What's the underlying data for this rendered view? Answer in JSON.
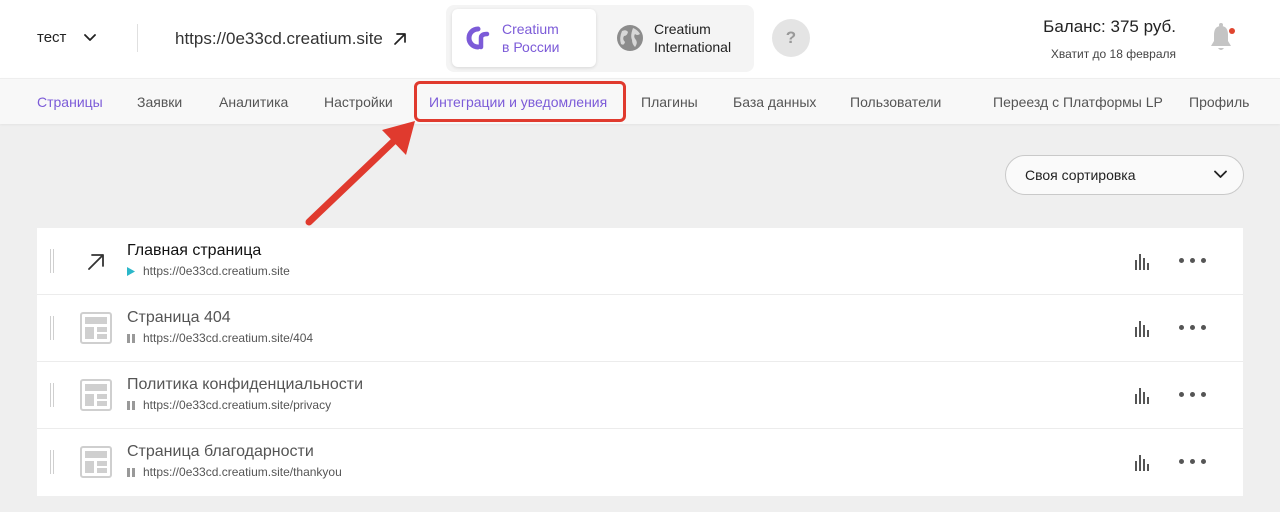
{
  "header": {
    "project_name": "тест",
    "site_url": "https://0e33cd.creatium.site",
    "region_ru_line1": "Creatium",
    "region_ru_line2": "в России",
    "region_int_line1": "Creatium",
    "region_int_line2": "International",
    "help_label": "?",
    "balance": "Баланс: 375 руб.",
    "balance_sub": "Хватит до 18 февраля"
  },
  "nav": {
    "items": [
      {
        "label": "Страницы"
      },
      {
        "label": "Заявки"
      },
      {
        "label": "Аналитика"
      },
      {
        "label": "Настройки"
      },
      {
        "label": "Интеграции и уведомления"
      },
      {
        "label": "Плагины"
      },
      {
        "label": "База данных"
      },
      {
        "label": "Пользователи"
      },
      {
        "label": "Переезд с Платформы LP"
      },
      {
        "label": "Профиль"
      }
    ]
  },
  "sort": {
    "label": "Своя сортировка"
  },
  "pages": [
    {
      "title": "Главная страница",
      "url": "https://0e33cd.creatium.site",
      "status": "published",
      "icon": "external-link-icon"
    },
    {
      "title": "Страница 404",
      "url": "https://0e33cd.creatium.site/404",
      "status": "paused",
      "icon": "page-layout-icon"
    },
    {
      "title": "Политика конфиденциальности",
      "url": "https://0e33cd.creatium.site/privacy",
      "status": "paused",
      "icon": "page-layout-icon"
    },
    {
      "title": "Страница благодарности",
      "url": "https://0e33cd.creatium.site/thankyou",
      "status": "paused",
      "icon": "page-layout-icon"
    }
  ],
  "colors": {
    "accent": "#7c5bd8",
    "highlight": "#e03a2e",
    "published": "#2bb7c9",
    "notification_dot": "#e0452e"
  }
}
